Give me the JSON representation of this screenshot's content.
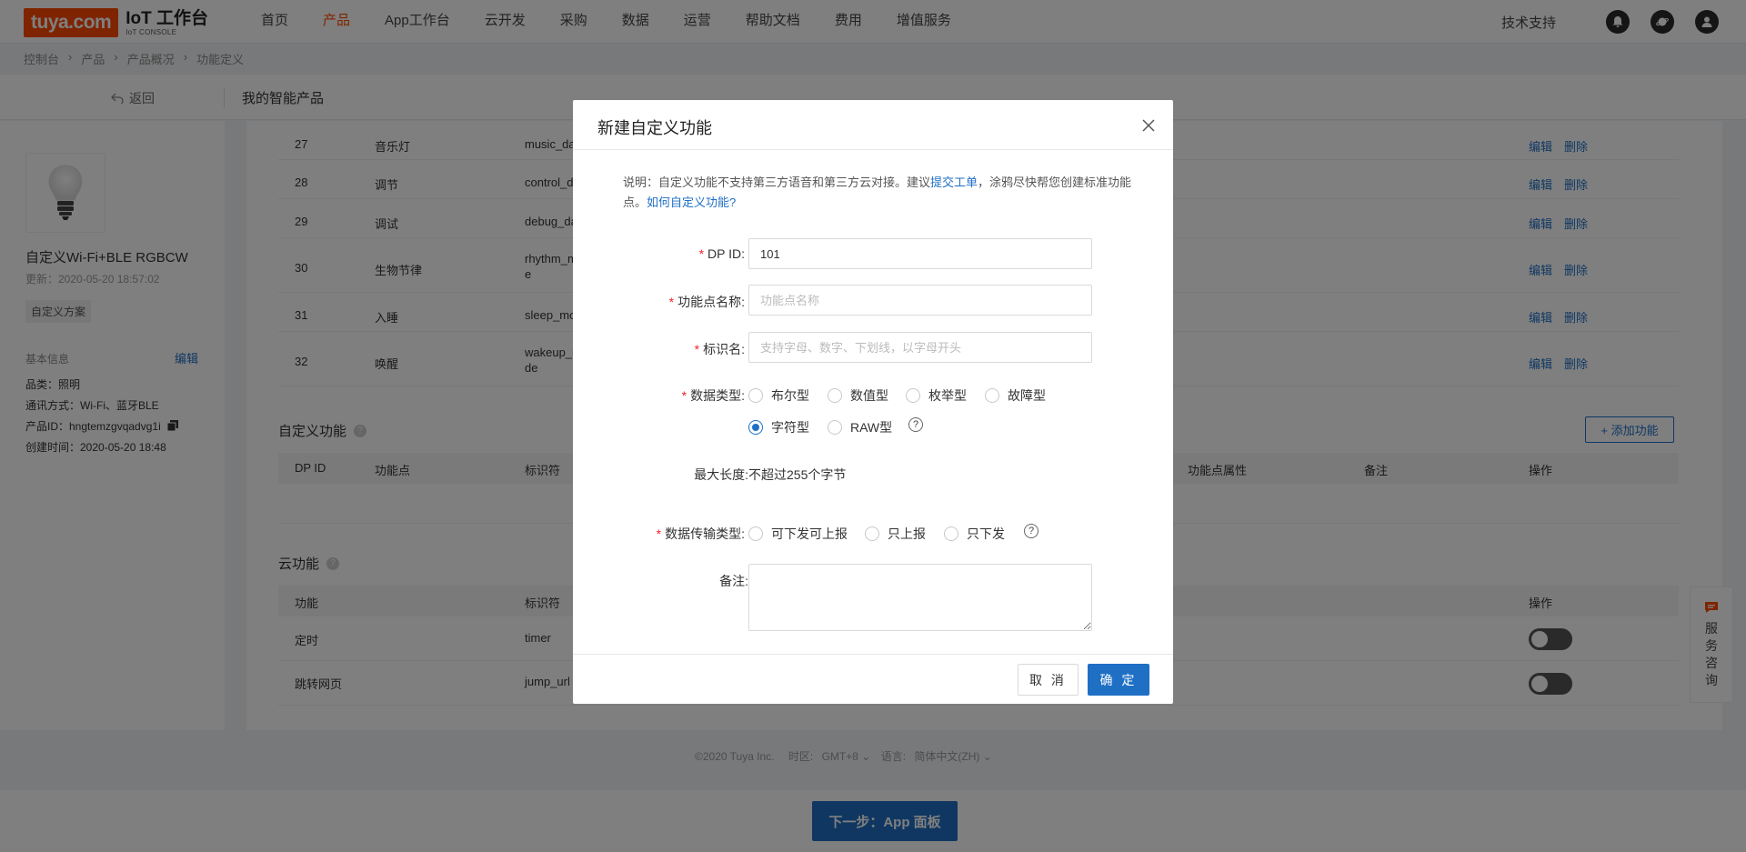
{
  "header": {
    "logo_brand": "tuya.com",
    "logo_title": "IoT 工作台",
    "logo_sub": "IoT CONSOLE",
    "nav": [
      "首页",
      "产品",
      "App工作台",
      "云开发",
      "采购",
      "数据",
      "运营",
      "帮助文档",
      "费用",
      "增值服务"
    ],
    "active_nav": "产品",
    "tech_support": "技术支持"
  },
  "breadcrumb": [
    "控制台",
    "产品",
    "产品概况",
    "功能定义"
  ],
  "subheader": {
    "back": "返回",
    "title": "我的智能产品"
  },
  "product": {
    "name": "自定义Wi-Fi+BLE RGBCW",
    "updated": "更新：2020-05-20 18:57:02",
    "tag": "自定义方案",
    "basic_info_label": "基本信息",
    "edit": "编辑",
    "category": "品类：照明",
    "protocol": "通讯方式：Wi-Fi、蓝牙BLE",
    "product_id": "产品ID：hngtemzgvqadvg1i",
    "created": "创建时间：2020-05-20 18:48"
  },
  "std_rows": [
    {
      "id": "27",
      "name": "音乐灯",
      "code": "music_da",
      "code2": ""
    },
    {
      "id": "28",
      "name": "调节",
      "code": "control_d",
      "code2": ""
    },
    {
      "id": "29",
      "name": "调试",
      "code": "debug_da",
      "code2": ""
    },
    {
      "id": "30",
      "name": "生物节律",
      "code": "rhythm_m",
      "code2": "e"
    },
    {
      "id": "31",
      "name": "入睡",
      "code": "sleep_mo",
      "code2": ""
    },
    {
      "id": "32",
      "name": "唤醒",
      "code": "wakeup_m",
      "code2": "de"
    }
  ],
  "row_ops": {
    "edit": "编辑",
    "delete": "删除"
  },
  "custom_section": {
    "title": "自定义功能",
    "add_button": "+ 添加功能",
    "headers": [
      "DP ID",
      "功能点",
      "标识符",
      "功能点属性",
      "备注",
      "操作"
    ]
  },
  "cloud_section": {
    "title": "云功能",
    "headers": [
      "功能",
      "标识符",
      "操作"
    ],
    "rows": [
      {
        "name": "定时",
        "code": "timer",
        "enabled": false
      },
      {
        "name": "跳转网页",
        "code": "jump_url",
        "enabled": false
      }
    ]
  },
  "footer": {
    "copyright": "©2020 Tuya Inc.",
    "timezone_label": "时区:",
    "timezone": "GMT+8",
    "lang_label": "语言:",
    "lang": "简体中文(ZH)"
  },
  "next_button": "下一步：App 面板",
  "service_float": [
    "服",
    "务",
    "咨",
    "询"
  ],
  "modal": {
    "title": "新建自定义功能",
    "close": "X",
    "note_prefix": "说明：自定义功能不支持第三方语音和第三方云对接。建议",
    "note_link1": "提交工单",
    "note_mid": "，涂鸦尽快帮您创建标准功能点。",
    "note_link2": "如何自定义功能?",
    "dp_id_label": "DP ID:",
    "dp_id_value": "101",
    "func_name_label": "功能点名称:",
    "func_name_placeholder": "功能点名称",
    "identifier_label": "标识名:",
    "identifier_placeholder": "支持字母、数字、下划线，以字母开头",
    "data_type_label": "数据类型:",
    "data_types": [
      "布尔型",
      "数值型",
      "枚举型",
      "故障型",
      "字符型",
      "RAW型"
    ],
    "data_type_selected": "字符型",
    "max_len_label": "最大长度:",
    "max_len_value": "不超过255个字节",
    "transfer_label": "数据传输类型:",
    "transfer_types": [
      "可下发可上报",
      "只上报",
      "只下发"
    ],
    "remark_label": "备注:",
    "cancel": "取 消",
    "ok": "确 定"
  },
  "colors": {
    "accent": "#ff4800",
    "primary": "#1f6fc5",
    "required": "#f5222d"
  }
}
